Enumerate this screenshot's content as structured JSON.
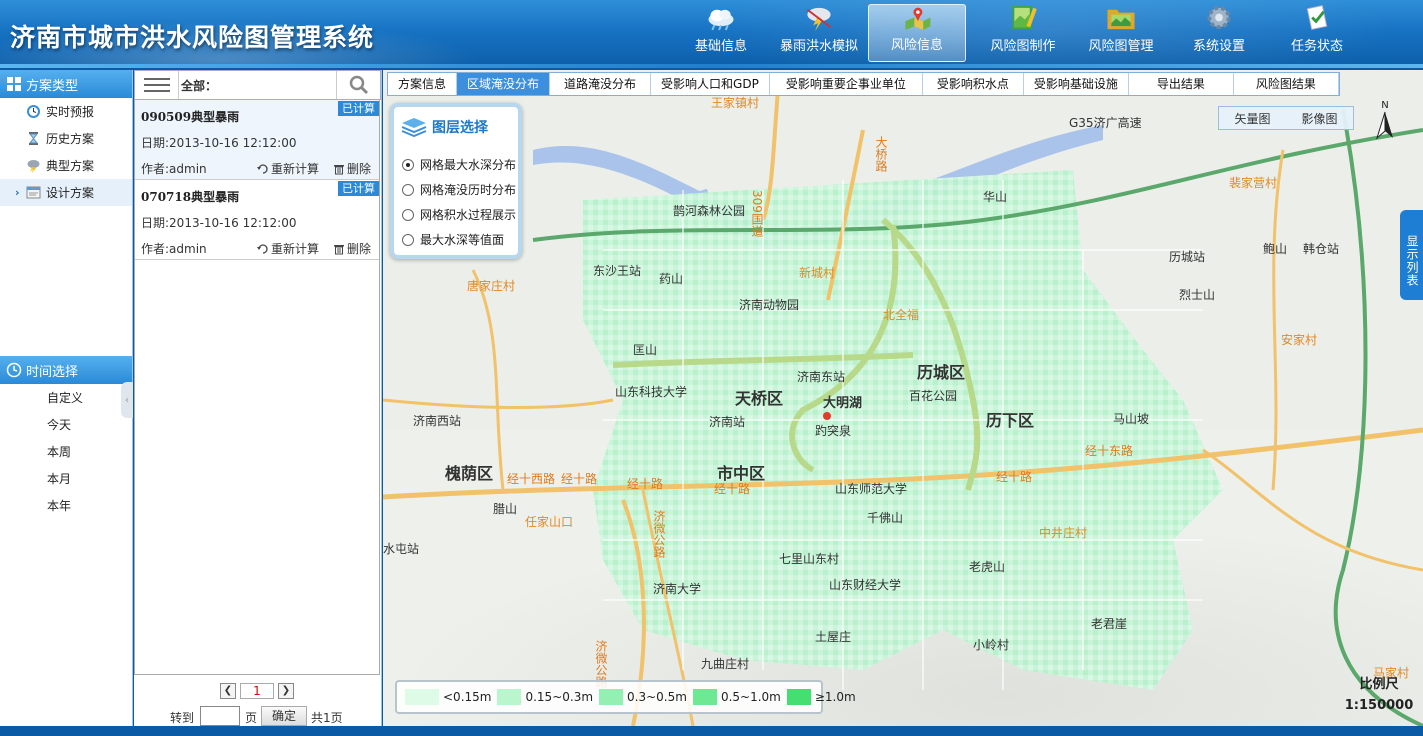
{
  "app": {
    "title": "济南市城市洪水风险图管理系统"
  },
  "topnav": [
    {
      "label": "基础信息",
      "icon": "cloud-icon",
      "active": false
    },
    {
      "label": "暴雨洪水模拟",
      "icon": "storm-icon",
      "active": false
    },
    {
      "label": "风险信息",
      "icon": "map-pin-icon",
      "active": true
    },
    {
      "label": "风险图制作",
      "icon": "map-edit-icon",
      "active": false
    },
    {
      "label": "风险图管理",
      "icon": "folder-icon",
      "active": false
    },
    {
      "label": "系统设置",
      "icon": "gear-icon",
      "active": false
    },
    {
      "label": "任务状态",
      "icon": "task-icon",
      "active": false
    }
  ],
  "sidebar": {
    "scheme_header": "方案类型",
    "schemes": [
      {
        "label": "实时预报",
        "icon": "clock-icon"
      },
      {
        "label": "历史方案",
        "icon": "hourglass-icon"
      },
      {
        "label": "典型方案",
        "icon": "rain-cloud-icon"
      },
      {
        "label": "设计方案",
        "icon": "document-icon",
        "active": true
      }
    ],
    "time_header": "时间选择",
    "times": [
      "自定义",
      "今天",
      "本周",
      "本月",
      "本年"
    ]
  },
  "list": {
    "filter_label": "全部：",
    "items": [
      {
        "title": "090509典型暴雨",
        "badge": "已计算",
        "date": "日期:2013-10-16 12:12:00",
        "author": "作者:admin",
        "recalc": "重新计算",
        "delete": "删除"
      },
      {
        "title": "070718典型暴雨",
        "badge": "已计算",
        "date": "日期:2013-10-16 12:12:00",
        "author": "作者:admin",
        "recalc": "重新计算",
        "delete": "删除"
      }
    ],
    "pager": {
      "prev": "❮",
      "current": "1",
      "next": "❯",
      "goto": "转到",
      "page": "页",
      "ok": "确定",
      "total": "共1页"
    }
  },
  "map": {
    "tabs": [
      "方案信息",
      "区域淹没分布",
      "道路淹没分布",
      "受影响人口和GDP",
      "受影响重要企事业单位",
      "受影响积水点",
      "受影响基础设施",
      "导出结果",
      "风险图结果"
    ],
    "active_tab": 1,
    "layer_panel": {
      "title": "图层选择",
      "options": [
        "网格最大水深分布",
        "网格淹没历时分布",
        "网格积水过程展示",
        "最大水深等值面"
      ],
      "selected": 0
    },
    "basemap": {
      "vector": "矢量图",
      "imagery": "影像图"
    },
    "north": "N",
    "side_tab": "显示列表",
    "legend": [
      {
        "label": "<0.15m",
        "color": "#ddfbe6"
      },
      {
        "label": "0.15~0.3m",
        "color": "#b9f6cd"
      },
      {
        "label": "0.3~0.5m",
        "color": "#93efb2"
      },
      {
        "label": "0.5~1.0m",
        "color": "#6ee893"
      },
      {
        "label": "≥1.0m",
        "color": "#45de71"
      }
    ],
    "scale": {
      "title": "比例尺",
      "value": "1:150000"
    },
    "labels": {
      "districts": [
        "天桥区",
        "历城区",
        "历下区",
        "市中区",
        "槐荫区"
      ],
      "places": [
        "东沙王站",
        "药山",
        "济南动物园",
        "匡山",
        "山东科技大学",
        "济南站",
        "济南西站",
        "济南东站",
        "大明湖",
        "趵突泉",
        "百花公园",
        "马山坡",
        "山东师范大学",
        "千佛山",
        "七里山东村",
        "山东财经大学",
        "济南大学",
        "老虎山",
        "老君崖",
        "腊山",
        "水屯站",
        "鹊山",
        "华山",
        "历城站",
        "烈士山",
        "韩仓站",
        "鲍山",
        "鹊河森林公园",
        "土屋庄",
        "小岭村",
        "九曲庄村"
      ],
      "orange_places": [
        "唐家庄村",
        "新城村",
        "北全福",
        "任家山口",
        "中井庄村",
        "安家村",
        "裴家营村",
        "马家村",
        "王家镇村"
      ],
      "roads": [
        "经十西路",
        "经十路",
        "经十路",
        "经十路",
        "经十路",
        "经十东路",
        "济微公路",
        "G35济广高速",
        "大桥路",
        "309国道",
        "济微公路"
      ]
    }
  }
}
